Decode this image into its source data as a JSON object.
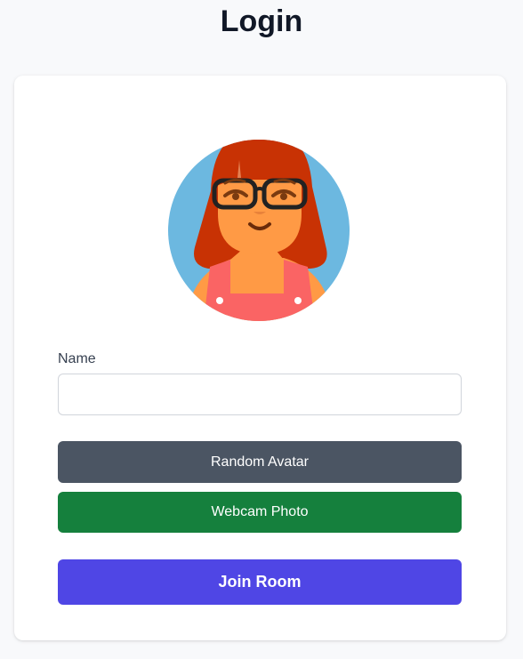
{
  "header": {
    "title": "Login"
  },
  "form": {
    "name_label": "Name",
    "name_value": "",
    "random_avatar_label": "Random Avatar",
    "webcam_photo_label": "Webcam Photo",
    "join_room_label": "Join Room"
  },
  "colors": {
    "background": "#f8f9fb",
    "random_button": "#4b5563",
    "webcam_button": "#15803d",
    "join_button": "#4f46e5"
  },
  "icons": {
    "avatar": "cartoon-avatar-girl-with-glasses"
  }
}
